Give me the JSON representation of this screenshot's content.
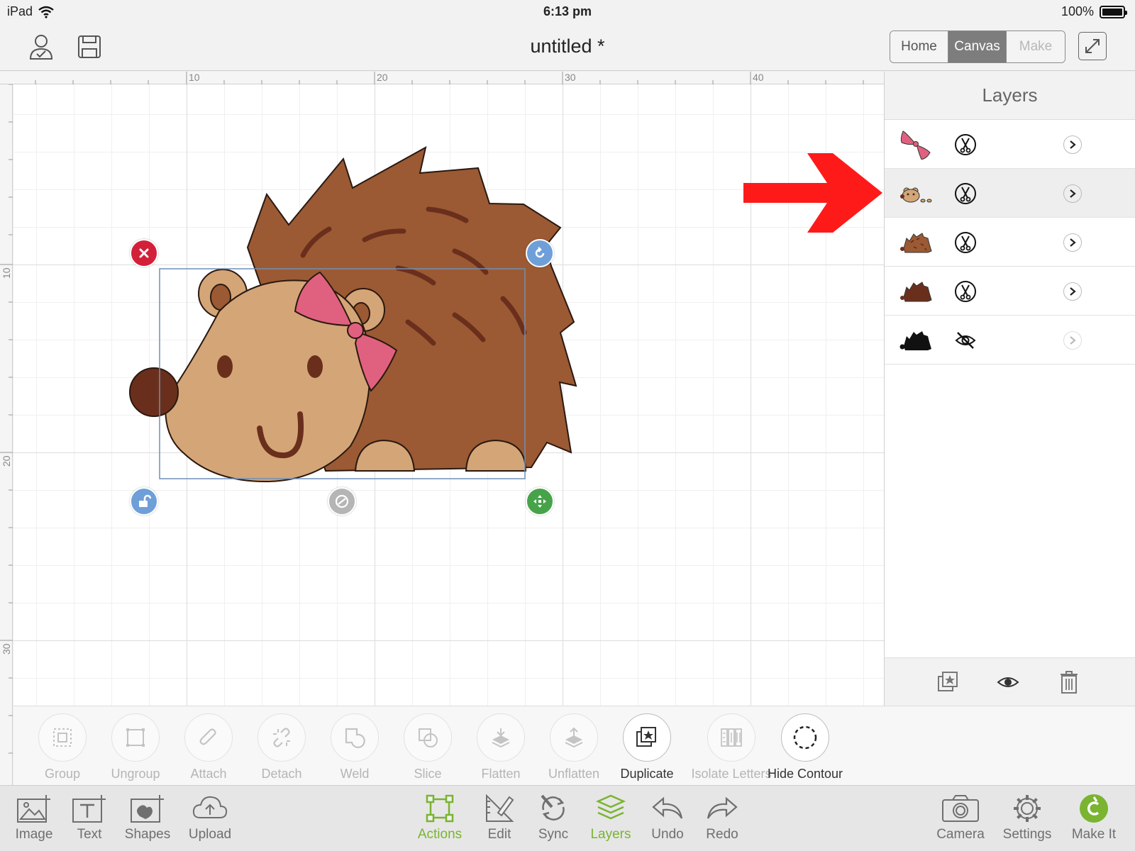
{
  "status_bar": {
    "device": "iPad",
    "time": "6:13 pm",
    "battery": "100%"
  },
  "header": {
    "title": "untitled *",
    "modes": [
      {
        "label": "Home",
        "state": "normal"
      },
      {
        "label": "Canvas",
        "state": "active"
      },
      {
        "label": "Make",
        "state": "disabled"
      }
    ]
  },
  "rulers": {
    "top": [
      "10",
      "20",
      "30",
      "40"
    ],
    "left": [
      "10",
      "20",
      "30"
    ]
  },
  "layers": {
    "title": "Layers",
    "rows": [
      {
        "thumb": "bow-thumbnail",
        "op": "cut-icon",
        "selected": false
      },
      {
        "thumb": "face-details-thumbnail",
        "op": "cut-icon",
        "selected": true
      },
      {
        "thumb": "spike-details-thumbnail",
        "op": "cut-icon",
        "selected": false
      },
      {
        "thumb": "hedgehog-body-thumbnail",
        "op": "cut-icon",
        "selected": false
      },
      {
        "thumb": "hedgehog-contour-thumbnail",
        "op": "hidden-eye-icon",
        "selected": false
      }
    ]
  },
  "actions": [
    {
      "label": "Group",
      "enabled": false
    },
    {
      "label": "Ungroup",
      "enabled": false
    },
    {
      "label": "Attach",
      "enabled": false
    },
    {
      "label": "Detach",
      "enabled": false
    },
    {
      "label": "Weld",
      "enabled": false
    },
    {
      "label": "Slice",
      "enabled": false
    },
    {
      "label": "Flatten",
      "enabled": false
    },
    {
      "label": "Unflatten",
      "enabled": false
    },
    {
      "label": "Duplicate",
      "enabled": true
    },
    {
      "label": "Isolate Letters",
      "enabled": false
    },
    {
      "label": "Hide Contour",
      "enabled": true
    }
  ],
  "toolbar": {
    "left": [
      "Image",
      "Text",
      "Shapes",
      "Upload"
    ],
    "center": [
      "Actions",
      "Edit",
      "Sync",
      "Layers",
      "Undo",
      "Redo"
    ],
    "right": [
      "Camera",
      "Settings",
      "Make It"
    ],
    "active": [
      "Actions",
      "Layers"
    ]
  },
  "colors": {
    "accent_green": "#7ab431",
    "hedgehog_brown": "#9b5a33",
    "face_tan": "#d4a576",
    "bow_pink": "#e0617f",
    "delete_red": "#d3203a",
    "handle_blue": "#6f9fd8",
    "move_green": "#46a349",
    "annotation_red": "#ff1a1a"
  }
}
